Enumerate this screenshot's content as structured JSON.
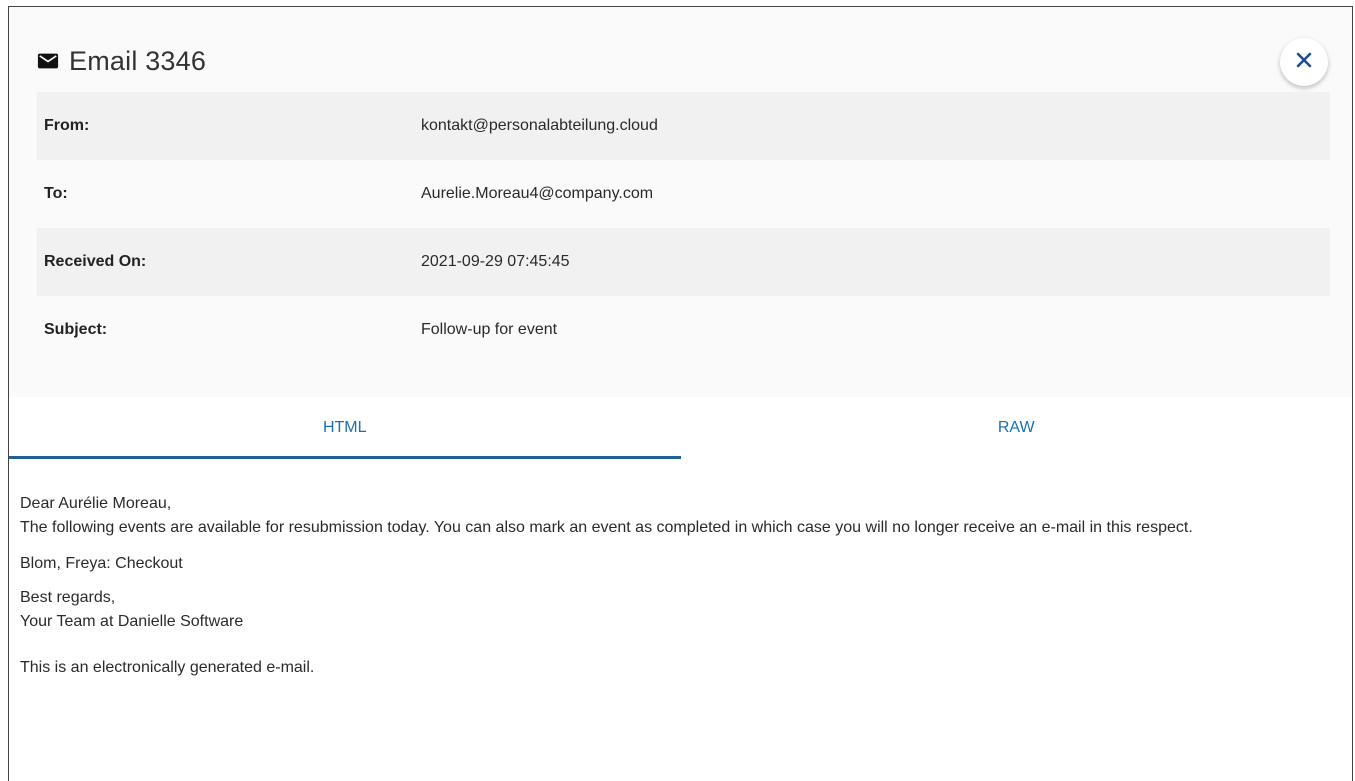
{
  "header": {
    "title": "Email 3346"
  },
  "meta": [
    {
      "label": "From:",
      "value": "kontakt@personalabteilung.cloud"
    },
    {
      "label": "To:",
      "value": "Aurelie.Moreau4@company.com"
    },
    {
      "label": "Received On:",
      "value": "2021-09-29 07:45:45"
    },
    {
      "label": "Subject:",
      "value": "Follow-up for event"
    }
  ],
  "tabs": [
    {
      "label": "HTML",
      "active": true
    },
    {
      "label": "RAW",
      "active": false
    }
  ],
  "body": {
    "greeting": "Dear Aurélie Moreau,",
    "intro": "The following events are available for resubmission today. You can also mark an event as completed in which case you will no longer receive an e-mail in this respect.",
    "event": "Blom, Freya: Checkout",
    "closing": "Best regards,",
    "signature": "Your Team at Danielle Software",
    "footer": "This is an electronically generated e-mail."
  },
  "colors": {
    "accent": "#1a6fb5",
    "tab_underline": "#1f5f9b",
    "close_icon": "#1d4f91",
    "row_shade": "#f1f1f1"
  },
  "icons": {
    "title_icon": "envelope-icon",
    "close": "close-icon"
  }
}
